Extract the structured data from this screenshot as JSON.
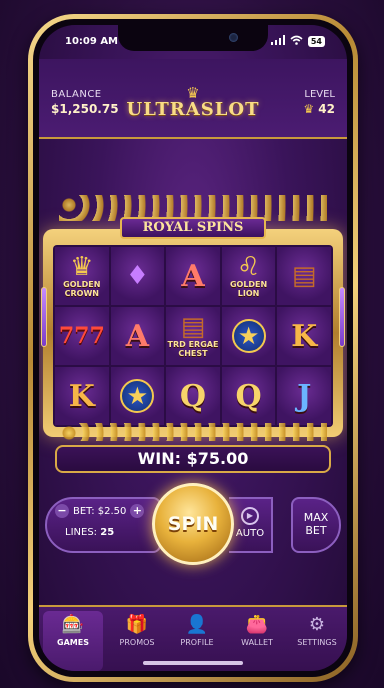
{
  "status_bar": {
    "time": "10:09 AM",
    "battery": "54"
  },
  "header": {
    "balance_label": "BALANCE",
    "balance_value": "$1,250.75",
    "logo_text": "ULTRASLOT",
    "level_label": "LEVEL",
    "level_value": "42"
  },
  "machine": {
    "title": "ROYAL SPINS",
    "reels": [
      [
        {
          "type": "icon",
          "icon": "crown-icon",
          "glyph": "♛",
          "caption": "GOLDEN CROWN",
          "color": "#f4c84f"
        },
        {
          "type": "icon",
          "icon": "gem-icon",
          "glyph": "♦",
          "caption": "",
          "color": "#c77dff"
        },
        {
          "type": "letter",
          "text": "A",
          "cls": "sym-A"
        },
        {
          "type": "icon",
          "icon": "lion-icon",
          "glyph": "♌",
          "caption": "GOLDEN LION",
          "color": "#f4c84f"
        },
        {
          "type": "icon",
          "icon": "treasure-chest-icon",
          "glyph": "▤",
          "caption": "",
          "color": "#c46a2a"
        }
      ],
      [
        {
          "type": "letter",
          "text": "777",
          "cls": "sym-777"
        },
        {
          "type": "letter",
          "text": "A",
          "cls": "sym-A"
        },
        {
          "type": "icon",
          "icon": "treasure-chest-icon",
          "glyph": "▤",
          "caption": "TRD ERGAE CHEST",
          "color": "#c46a2a"
        },
        {
          "type": "star",
          "icon": "star-icon"
        },
        {
          "type": "letter",
          "text": "K",
          "cls": "sym-K"
        }
      ],
      [
        {
          "type": "letter",
          "text": "K",
          "cls": "sym-K"
        },
        {
          "type": "star",
          "icon": "star-icon"
        },
        {
          "type": "letter",
          "text": "Q",
          "cls": "sym-Q"
        },
        {
          "type": "letter",
          "text": "Q",
          "cls": "sym-Q"
        },
        {
          "type": "letter",
          "text": "J",
          "cls": "sym-J"
        }
      ]
    ]
  },
  "win": {
    "text": "WIN: $75.00"
  },
  "controls": {
    "bet_label": "BET: $2.50",
    "minus": "−",
    "plus": "+",
    "lines_label": "LINES:",
    "lines_value": "25",
    "spin_label": "SPIN",
    "auto_label": "AUTO",
    "max_bet_line1": "MAX",
    "max_bet_line2": "BET"
  },
  "tabs": [
    {
      "label": "GAMES",
      "icon": "slot-machine-icon",
      "glyph": "🎰",
      "active": true
    },
    {
      "label": "PROMOS",
      "icon": "gift-icon",
      "glyph": "🎁",
      "active": false
    },
    {
      "label": "PROFILE",
      "icon": "user-icon",
      "glyph": "👤",
      "active": false
    },
    {
      "label": "WALLET",
      "icon": "wallet-icon",
      "glyph": "👛",
      "active": false
    },
    {
      "label": "SETTINGS",
      "icon": "gear-icon",
      "glyph": "⚙",
      "active": false
    }
  ]
}
